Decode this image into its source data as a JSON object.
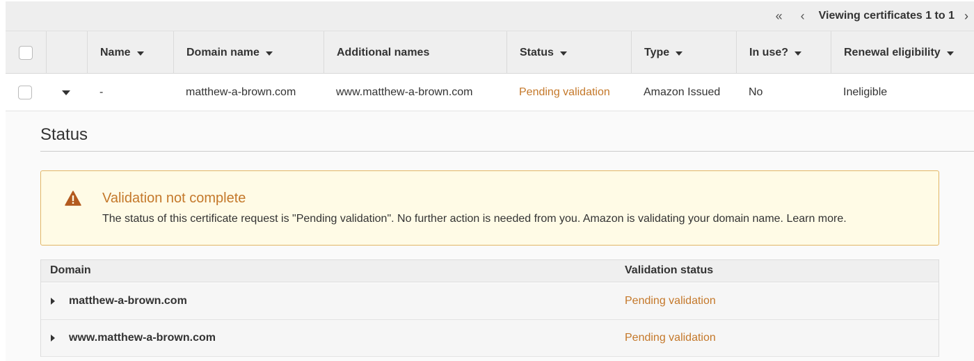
{
  "pagination": {
    "first_icon": "«",
    "prev_icon": "‹",
    "text": "Viewing certificates 1 to 1",
    "next_icon": "›"
  },
  "table": {
    "columns": {
      "name": "Name",
      "domain_name": "Domain name",
      "additional_names": "Additional names",
      "status": "Status",
      "type": "Type",
      "in_use": "In use?",
      "renewal": "Renewal eligibility"
    },
    "row": {
      "name": "-",
      "domain_name": "matthew-a-brown.com",
      "additional_names": "www.matthew-a-brown.com",
      "status": "Pending validation",
      "type": "Amazon Issued",
      "in_use": "No",
      "renewal": "Ineligible"
    }
  },
  "details": {
    "title": "Status",
    "alert": {
      "icon": "warning-icon",
      "title": "Validation not complete",
      "message": "The status of this certificate request is \"Pending validation\". No further action is needed from you. Amazon is validating your domain name.",
      "link": "Learn more."
    },
    "validation_table": {
      "header_domain": "Domain",
      "header_status": "Validation status",
      "rows": [
        {
          "domain": "matthew-a-brown.com",
          "status": "Pending validation"
        },
        {
          "domain": "www.matthew-a-brown.com",
          "status": "Pending validation"
        }
      ]
    }
  },
  "colors": {
    "pending": "#c4782a",
    "alert_bg": "#fffbe6",
    "alert_border": "#e2b665",
    "warning_icon": "#b35a1f"
  }
}
